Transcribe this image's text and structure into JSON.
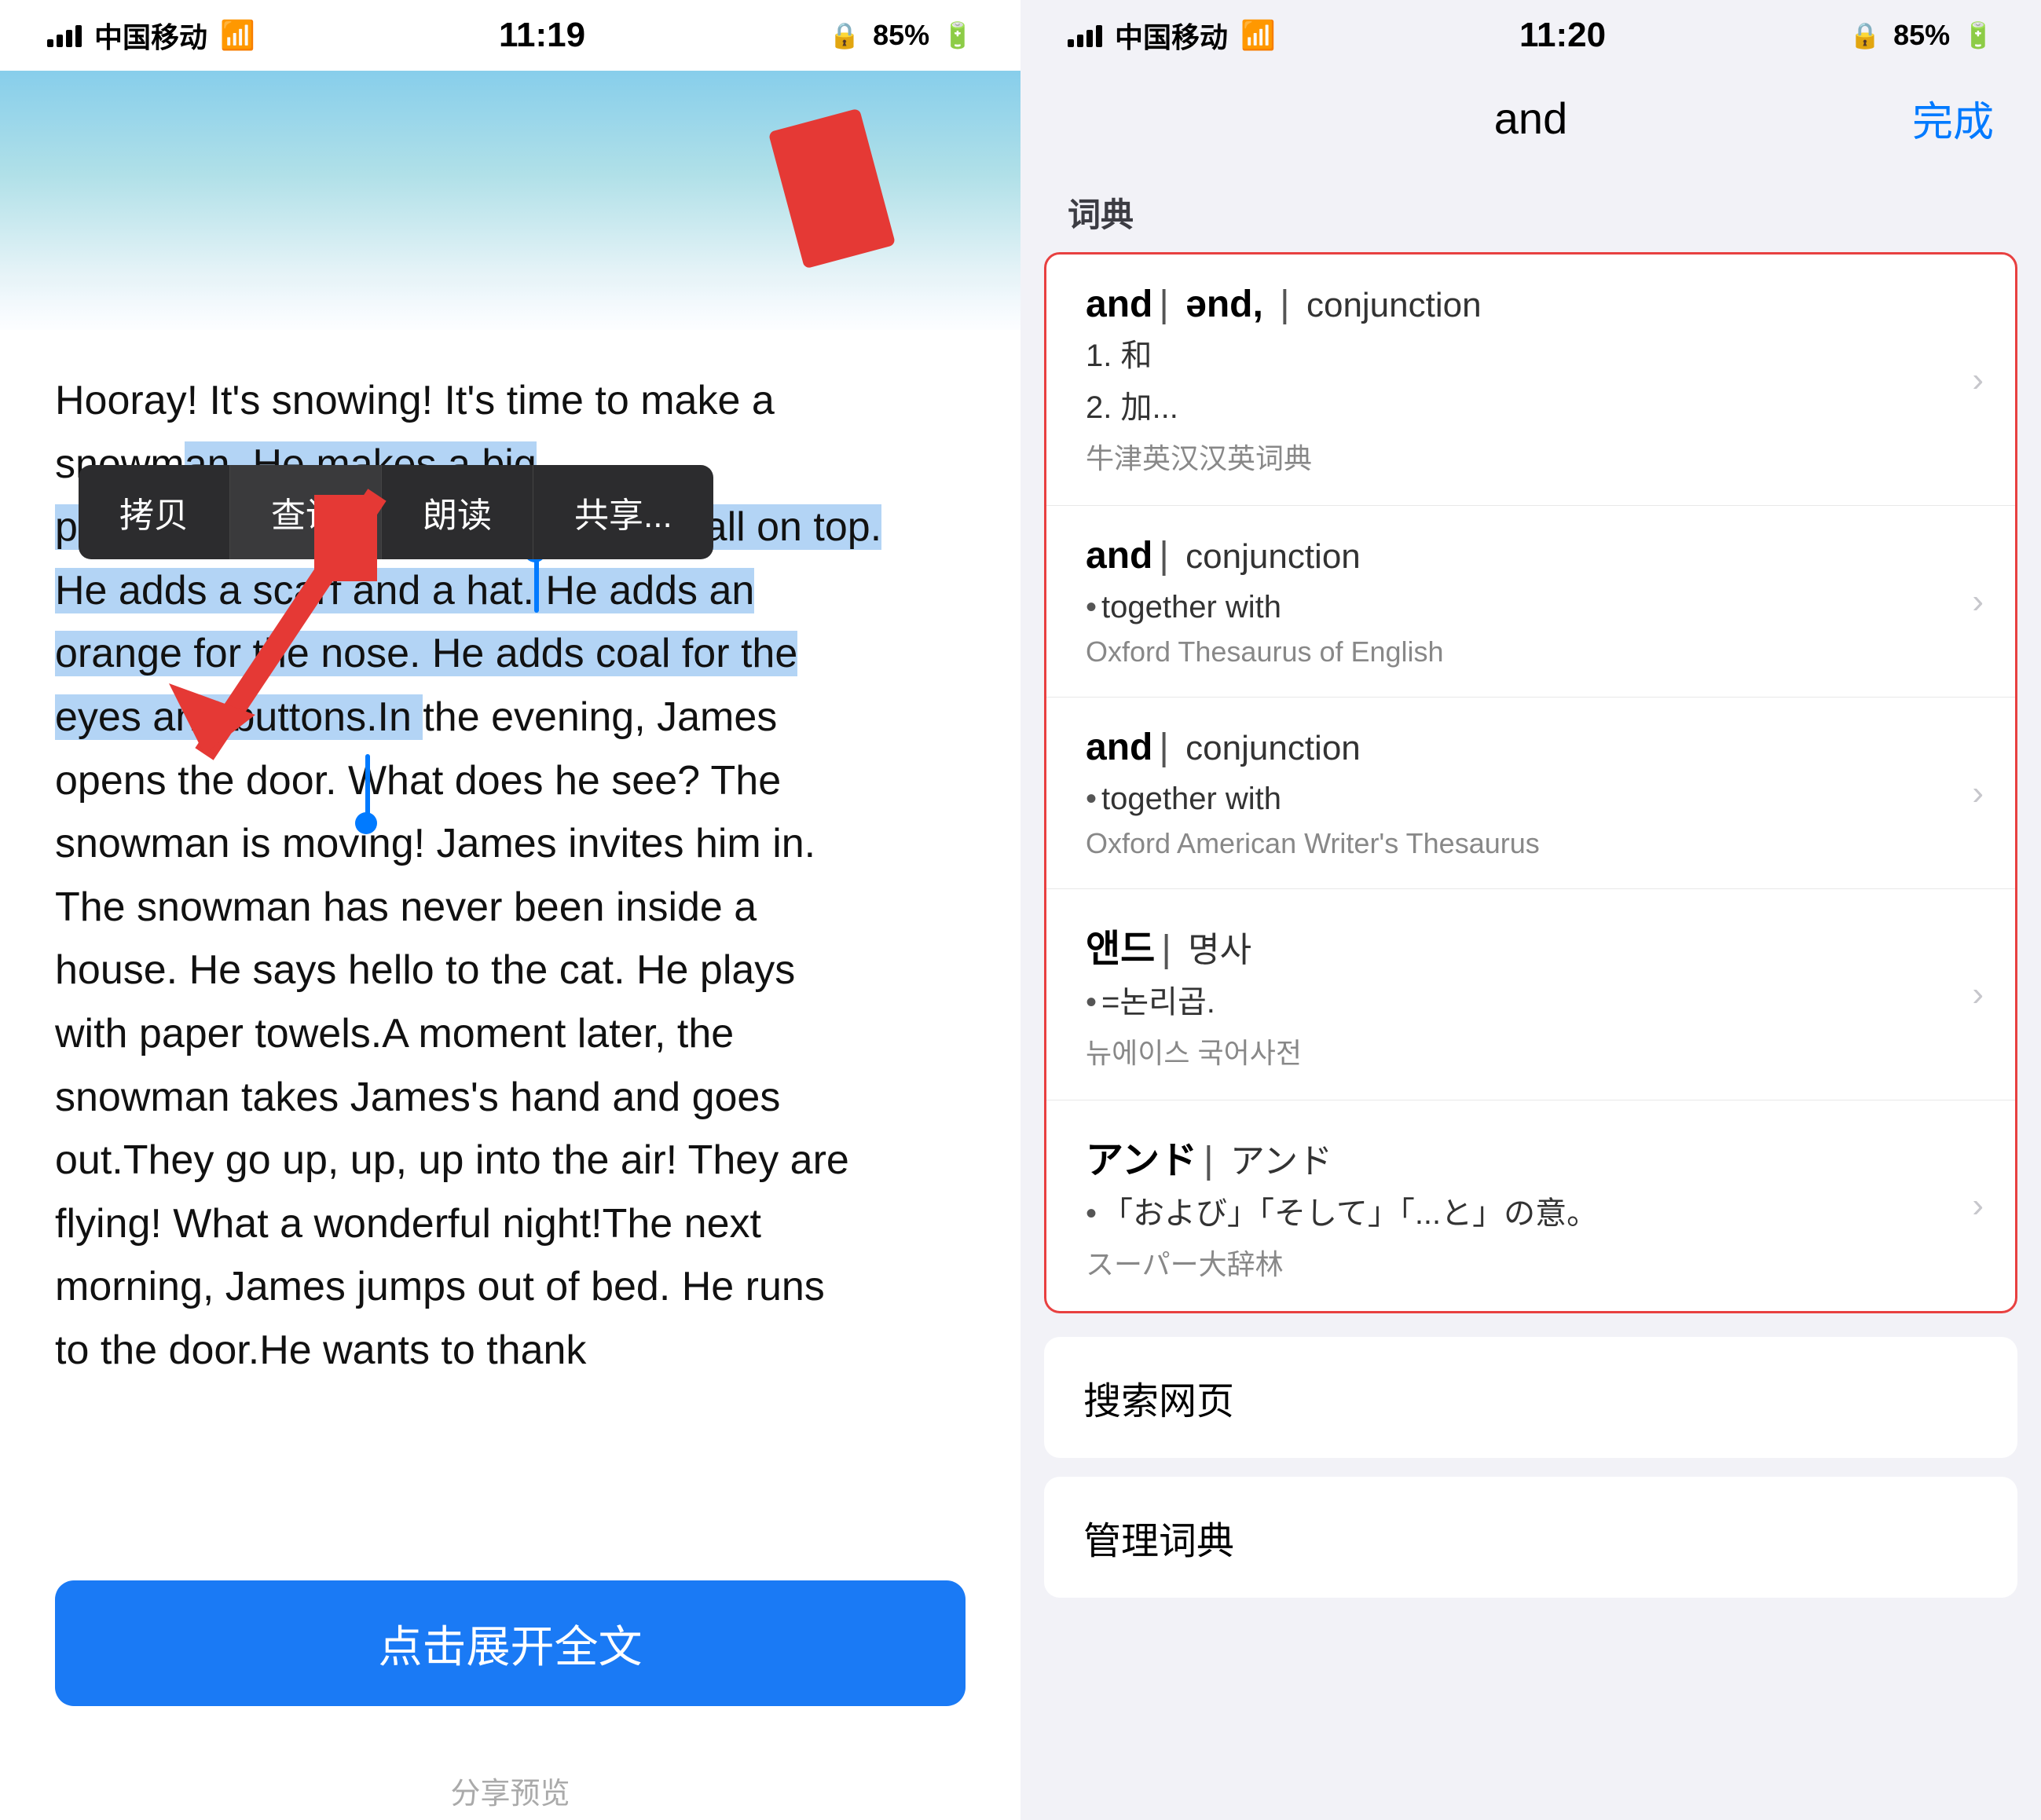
{
  "left": {
    "status": {
      "carrier": "中国移动",
      "time": "11:19",
      "battery": "85%"
    },
    "context_menu": {
      "items": [
        "拷贝",
        "查询",
        "朗读",
        "共享..."
      ]
    },
    "book_text_lines": [
      "Hooray! It's snowing! It's time to make a",
      "snowman. He makes a big",
      "pile of snow. He makes a big snowball on top.",
      "He adds a scarf and a hat. He adds an",
      "orange for the nose. He adds coal for the",
      "eyes and buttons.In the evening, James",
      "opens the door. What does he see? The",
      "snowman is moving! James invites him in.",
      "The snowman has never been inside a",
      "house. He says hello to the cat. He plays",
      "with paper towels.A moment later, the",
      "snowman takes James's hand and goes",
      "out.They go up, up, up into the air! They are",
      "flying! What a wonderful night!The next",
      "morning, James jumps out of bed. He runs",
      "to the door.He wants to thank"
    ],
    "expand_button": "点击展开全文",
    "share_hint": "分享预览"
  },
  "right": {
    "status": {
      "carrier": "中国移动",
      "time": "11:20",
      "battery": "85%"
    },
    "header": {
      "title": "and",
      "done": "完成"
    },
    "section_label": "词典",
    "entries": [
      {
        "word": "and",
        "phonetic": "ənd,",
        "pos": "conjunction",
        "definitions": [
          "1. 和",
          "2. 加..."
        ],
        "source": "牛津英汉汉英词典"
      },
      {
        "word": "and",
        "phonetic": "",
        "pos": "conjunction",
        "definitions": [
          "• together with"
        ],
        "source": "Oxford Thesaurus of English"
      },
      {
        "word": "and",
        "phonetic": "",
        "pos": "conjunction",
        "definitions": [
          "• together with"
        ],
        "source": "Oxford American Writer's Thesaurus"
      },
      {
        "word": "앤드",
        "phonetic": "",
        "pos": "명사",
        "definitions": [
          "• =논리곱."
        ],
        "source": "뉴에이스 국어사전"
      },
      {
        "word": "アンド",
        "phonetic": "",
        "pos": "アンド",
        "definitions": [
          "•「および」「そして」「...と」の意。"
        ],
        "source": "スーパー大辞林"
      }
    ],
    "bottom_items": [
      "搜索网页",
      "管理词典"
    ]
  }
}
